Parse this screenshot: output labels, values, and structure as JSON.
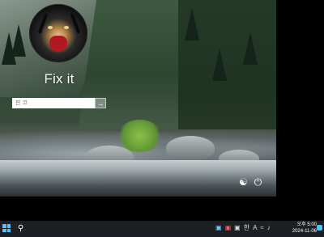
{
  "lock_screen": {
    "username": "Fix it",
    "pin_placeholder": "핀 코",
    "submit_glyph": "→",
    "corner_icons": [
      "accessibility-icon",
      "power-icon"
    ]
  },
  "taskbar": {
    "tray": {
      "ime_label": "한",
      "lang_label": "A",
      "clock_time": "오후 5:00",
      "clock_date": "2024-11-06"
    }
  }
}
